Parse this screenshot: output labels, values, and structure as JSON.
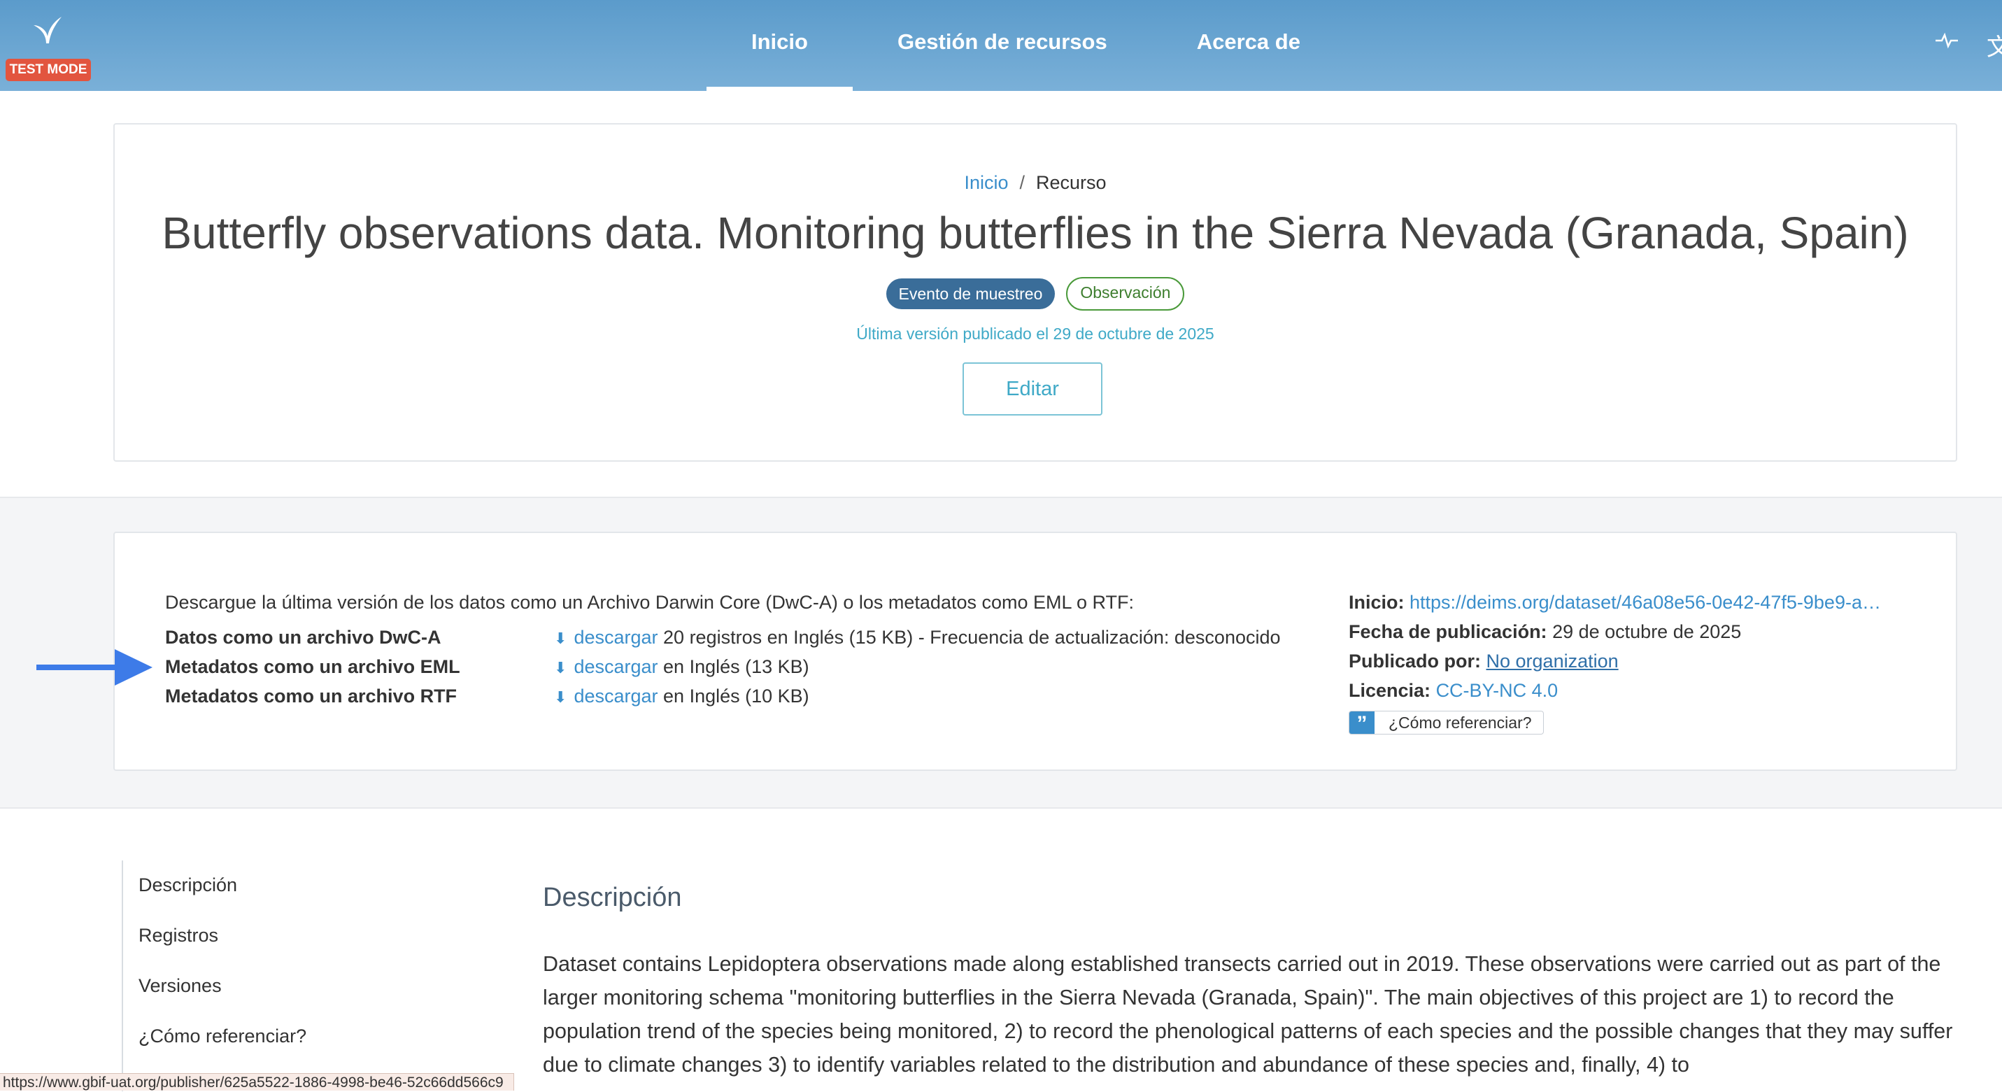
{
  "app": {
    "test_badge": "TEST MODE"
  },
  "nav": {
    "items": [
      {
        "label": "Inicio",
        "active": true
      },
      {
        "label": "Gestión de recursos",
        "active": false
      },
      {
        "label": "Acerca de",
        "active": false
      }
    ]
  },
  "header": {
    "breadcrumb": {
      "home": "Inicio",
      "separator": "/",
      "current": "Recurso"
    },
    "title": "Butterfly observations data. Monitoring butterflies in the Sierra Nevada (Granada, Spain)",
    "tags": {
      "type": "Evento de muestreo",
      "subtype": "Observación"
    },
    "version": "Última versión publicado el 29 de octubre de 2025",
    "edit_label": "Editar"
  },
  "downloads": {
    "intro": "Descargue la última versión de los datos como un Archivo Darwin Core (DwC-A) o los metadatos como EML o RTF:",
    "rows": [
      {
        "label": "Datos como un archivo DwC-A",
        "link": "descargar",
        "details": "20 registros en Inglés (15 KB) - Frecuencia de actualización: desconocido"
      },
      {
        "label": "Metadatos como un archivo EML",
        "link": "descargar",
        "details": "en Inglés (13 KB)"
      },
      {
        "label": "Metadatos como un archivo RTF",
        "link": "descargar",
        "details": "en Inglés (10 KB)"
      }
    ]
  },
  "metadata": {
    "home_label": "Inicio:",
    "home_value": "https://deims.org/dataset/46a08e56-0e42-47f5-9be9-a…",
    "pubdate_label": "Fecha de publicación:",
    "pubdate_value": "29 de octubre de 2025",
    "publisher_label": "Publicado por:",
    "publisher_value": "No organization",
    "license_label": "Licencia:",
    "license_value": "CC-BY-NC 4.0",
    "cite_label": "¿Cómo referenciar?"
  },
  "sidenav": {
    "items": [
      "Descripción",
      "Registros",
      "Versiones",
      "¿Cómo referenciar?"
    ]
  },
  "main": {
    "section_title": "Descripción",
    "description": "Dataset contains Lepidoptera observations made along established transects carried out in 2019. These observations were carried out as part of the larger monitoring schema \"monitoring butterflies in the Sierra Nevada (Granada, Spain)\". The main objectives of this project are 1) to record the population trend of the species being monitored, 2) to record the phenological patterns of each species and the possible changes that they may suffer due to climate changes 3) to identify variables related to the distribution and abundance of these species and, finally, 4) to"
  },
  "statusbar": {
    "url": "https://www.gbif-uat.org/publisher/625a5522-1886-4998-be46-52c66dd566c9"
  },
  "colors": {
    "accent": "#3a8ecb",
    "topbar": "#6aa6d2",
    "test_badge": "#e2553f",
    "arrow": "#3d7be8"
  },
  "icons": [
    "gbif-leaf-logo-icon",
    "activity-icon",
    "translate-icon",
    "download-icon",
    "quote-icon",
    "arrow-right-icon"
  ]
}
